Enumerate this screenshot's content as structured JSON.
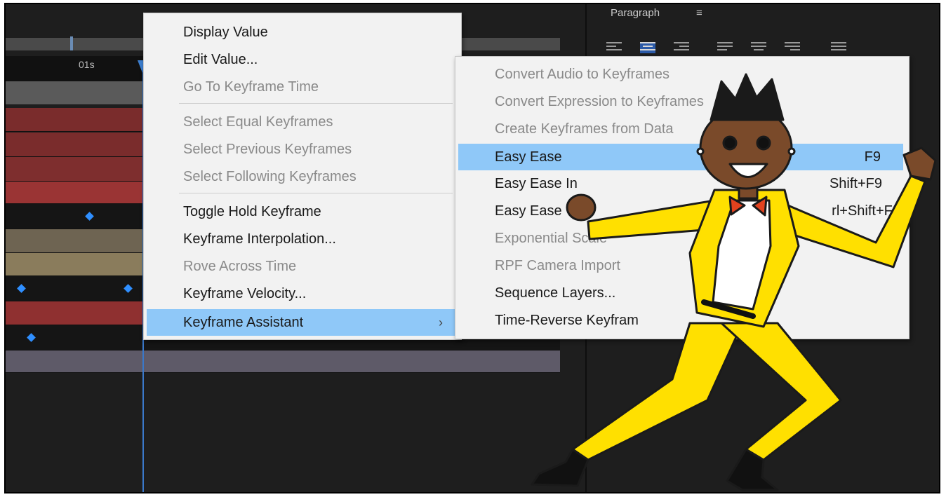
{
  "timeline": {
    "time_label": "01s"
  },
  "paragraph_panel": {
    "title": "Paragraph",
    "menu_icon": "≡"
  },
  "context_menu": {
    "items": [
      {
        "label": "Display Value",
        "enabled": true
      },
      {
        "label": "Edit Value...",
        "enabled": true
      },
      {
        "label": "Go To Keyframe Time",
        "enabled": false
      },
      {
        "label": "Select Equal Keyframes",
        "enabled": false
      },
      {
        "label": "Select Previous Keyframes",
        "enabled": false
      },
      {
        "label": "Select Following Keyframes",
        "enabled": false
      },
      {
        "label": "Toggle Hold Keyframe",
        "enabled": true
      },
      {
        "label": "Keyframe Interpolation...",
        "enabled": true
      },
      {
        "label": "Rove Across Time",
        "enabled": false
      },
      {
        "label": "Keyframe Velocity...",
        "enabled": true
      },
      {
        "label": "Keyframe Assistant",
        "enabled": true,
        "highlighted": true,
        "submenu_arrow": "›"
      }
    ]
  },
  "submenu": {
    "items": [
      {
        "label": "Convert Audio to Keyframes",
        "enabled": false
      },
      {
        "label": "Convert Expression to Keyframes",
        "enabled": false
      },
      {
        "label": "Create Keyframes from Data",
        "enabled": false
      },
      {
        "label": "Easy Ease",
        "shortcut": "F9",
        "enabled": true,
        "highlighted": true
      },
      {
        "label": "Easy Ease In",
        "shortcut": "Shift+F9",
        "enabled": true
      },
      {
        "label": "Easy Ease",
        "shortcut": "rl+Shift+F9",
        "enabled": true
      },
      {
        "label": "Exponential Scale",
        "enabled": false
      },
      {
        "label": "RPF Camera Import",
        "enabled": false
      },
      {
        "label": "Sequence Layers...",
        "enabled": true
      },
      {
        "label": "Time-Reverse Keyfram",
        "enabled": true
      }
    ]
  },
  "colors": {
    "highlight": "#8fc8f8",
    "keyframe": "#2f8fff",
    "playhead": "#3a78c9",
    "suit": "#ffe000"
  }
}
